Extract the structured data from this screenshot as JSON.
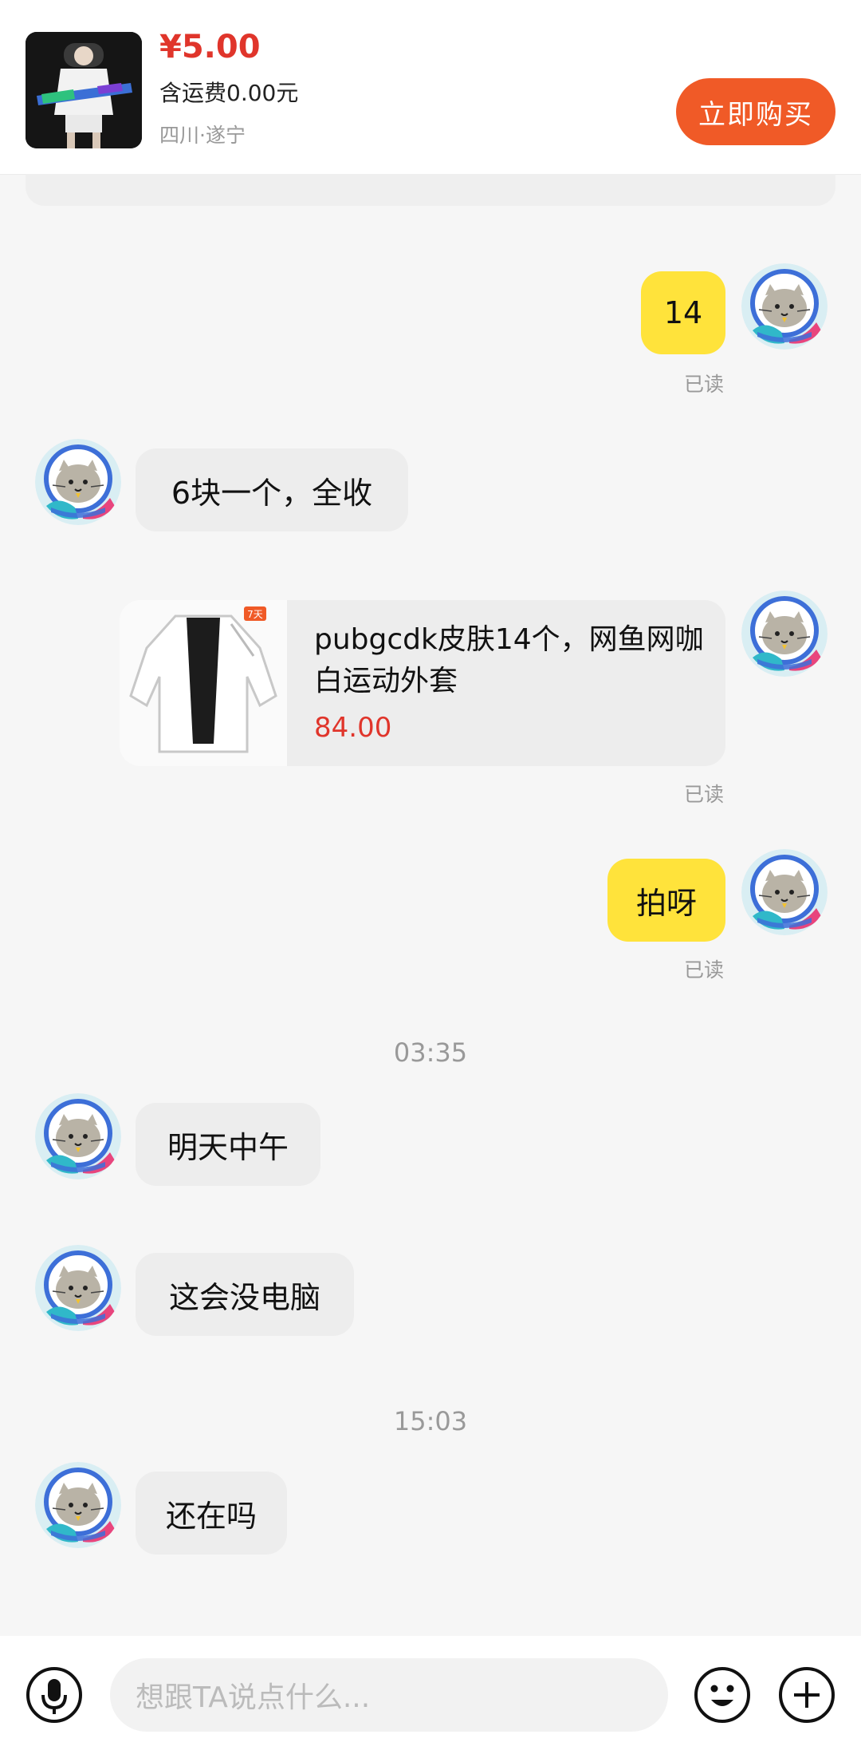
{
  "header": {
    "price": "¥5.00",
    "shipping": "含运费0.00元",
    "location": "四川·遂宁",
    "buy_label": "立即购买"
  },
  "messages": {
    "m1": {
      "text": "14",
      "read": "已读"
    },
    "m2": {
      "text": "6块一个，全收"
    },
    "m3": {
      "title": "pubgcdk皮肤14个，网鱼网咖白运动外套",
      "price": "84.00",
      "badge": "7天",
      "read": "已读"
    },
    "m4": {
      "text": "拍呀",
      "read": "已读"
    },
    "time1": "03:35",
    "m5": {
      "text": "明天中午"
    },
    "m6": {
      "text": "这会没电脑"
    },
    "time2": "15:03",
    "m7": {
      "text": "还在吗"
    }
  },
  "input": {
    "placeholder": "想跟TA说点什么..."
  },
  "colors": {
    "accent_orange": "#f05a27",
    "price_red": "#e0352b",
    "outgoing_bubble": "#ffe33b",
    "incoming_bubble": "#ededed"
  },
  "icons": [
    "microphone-icon",
    "emoji-icon",
    "plus-icon",
    "cat-avatar-icon"
  ]
}
